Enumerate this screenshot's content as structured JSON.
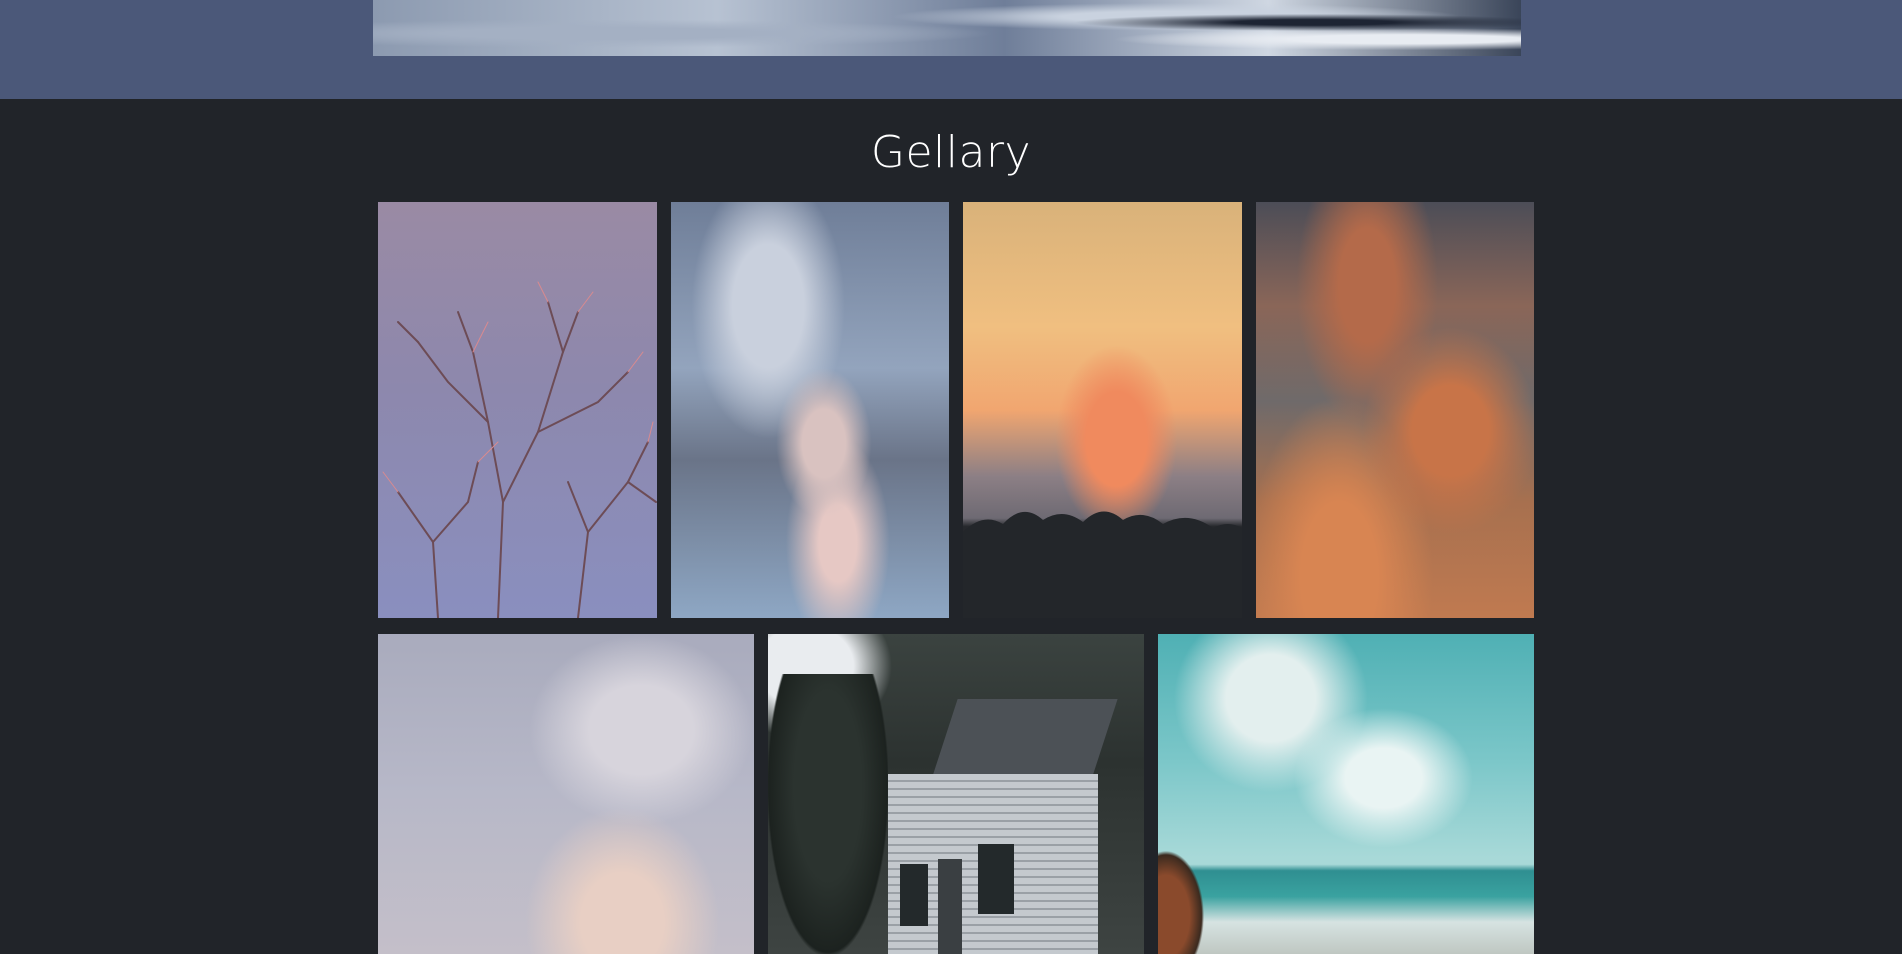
{
  "gallery": {
    "title": "Gellary"
  }
}
